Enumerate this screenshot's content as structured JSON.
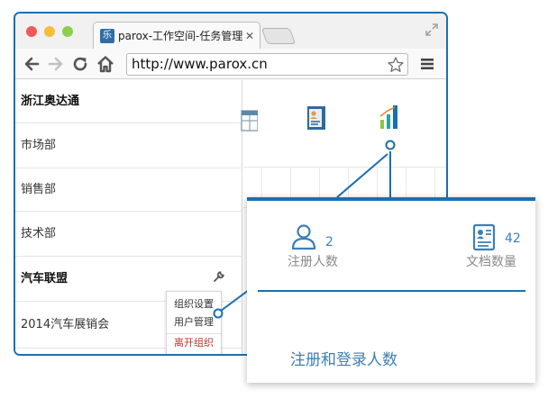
{
  "browser": {
    "tab_title": "parox-工作空间-任务管理",
    "tab_favicon_text": "乐",
    "url": "http://www.parox.cn"
  },
  "sidebar": {
    "items": [
      {
        "label": "浙江奥达通",
        "bold": true
      },
      {
        "label": "市场部",
        "bold": false
      },
      {
        "label": "销售部",
        "bold": false
      },
      {
        "label": "技术部",
        "bold": false
      },
      {
        "label": "汽车联盟",
        "bold": true
      },
      {
        "label": "2014汽车展销会",
        "bold": false
      }
    ]
  },
  "context_menu": {
    "items": [
      "组织设置",
      "用户管理",
      "离开组织"
    ]
  },
  "zoom_panel": {
    "stats": [
      {
        "icon": "user-icon",
        "value": "2",
        "label": "注册人数"
      },
      {
        "icon": "document-icon",
        "value": "42",
        "label": "文档数量"
      }
    ],
    "section_heading": "注册和登录人数"
  },
  "colors": {
    "accent": "#1a6fb2",
    "link": "#3d7fb6",
    "danger": "#c9302c"
  }
}
